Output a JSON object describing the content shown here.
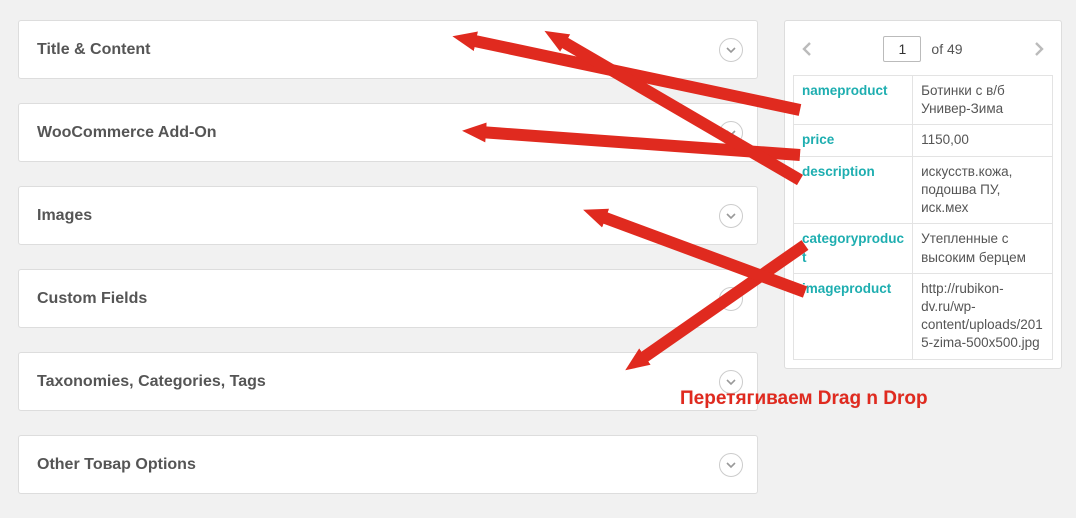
{
  "panels": [
    {
      "title": "Title & Content"
    },
    {
      "title": "WooCommerce Add-On"
    },
    {
      "title": "Images"
    },
    {
      "title": "Custom Fields"
    },
    {
      "title": "Taxonomies, Categories, Tags"
    },
    {
      "title": "Other Товар Options"
    }
  ],
  "pager": {
    "current": "1",
    "of_label": "of 49"
  },
  "fields": [
    {
      "key": "nameproduct",
      "value": "Ботинки с в/б Универ-Зима"
    },
    {
      "key": "price",
      "value": "1150,00"
    },
    {
      "key": "description",
      "value": "искусств.кожа, подошва ПУ, иск.мех"
    },
    {
      "key": "categoryproduct",
      "value": "Утепленные с высоким берцем"
    },
    {
      "key": "imageproduct",
      "value": "http://rubikon-dv.ru/wp-content/uploads/2015-zima-500x500.jpg"
    }
  ],
  "annotation": "Перетягиваем Drag n Drop"
}
